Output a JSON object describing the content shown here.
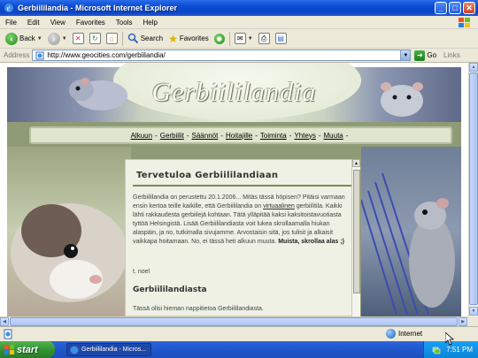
{
  "window": {
    "title": "Gerbiililandia - Microsoft Internet Explorer"
  },
  "menu": [
    "File",
    "Edit",
    "View",
    "Favorites",
    "Tools",
    "Help"
  ],
  "toolbar": {
    "back": "Back",
    "search": "Search",
    "favorites": "Favorites"
  },
  "address": {
    "label": "Address",
    "url": "http://www.geocities.com/gerbiilandia/",
    "go": "Go",
    "links": "Links"
  },
  "page": {
    "logo": "Gerbiililandia",
    "nav": [
      "Alkuun",
      "Gerbiilit",
      "Säännöt",
      "Hoitajille",
      "Toiminta",
      "Yhteys",
      "Muuta"
    ],
    "heading": "Tervetuloa Gerbiililandiaan",
    "intro_1": "Gerbiililandia on perustettu 20.1.2006... Mitäs tässä höpisen? Pitäisi varmaan ensin kertoa teille kaikille, että Gerbiililandia on ",
    "intro_link": "virtuaalinen",
    "intro_2": " gerbiilitila. Kaikki lähti rakkaudesta gerbiilejä kohtaan. Tätä ylläpitää kaksi kaksitoistavuotiasta tyttöä Helsingistä. Lisää Gerbiililandiasta voit lukea skrollaamalla hiukan alaspäin, ja no, tutkimalla sivujamme. Arvostaisin sitä, jos tulisit ja alkaisit vaikkapa hoitamaan. No, ei tässä heti alkuun muuta. ",
    "intro_bold": "Muista, skrollaa alas ;)",
    "signature": "t. noel",
    "subheading": "Gerbiililandiasta",
    "body2": "Tässä olisi hieman nappitietoa Gerbiililandiasta."
  },
  "status": {
    "zone": "Internet"
  },
  "taskbar": {
    "start": "start",
    "item": "Gerbiililandia - Micros...",
    "clock": "7:51 PM"
  }
}
